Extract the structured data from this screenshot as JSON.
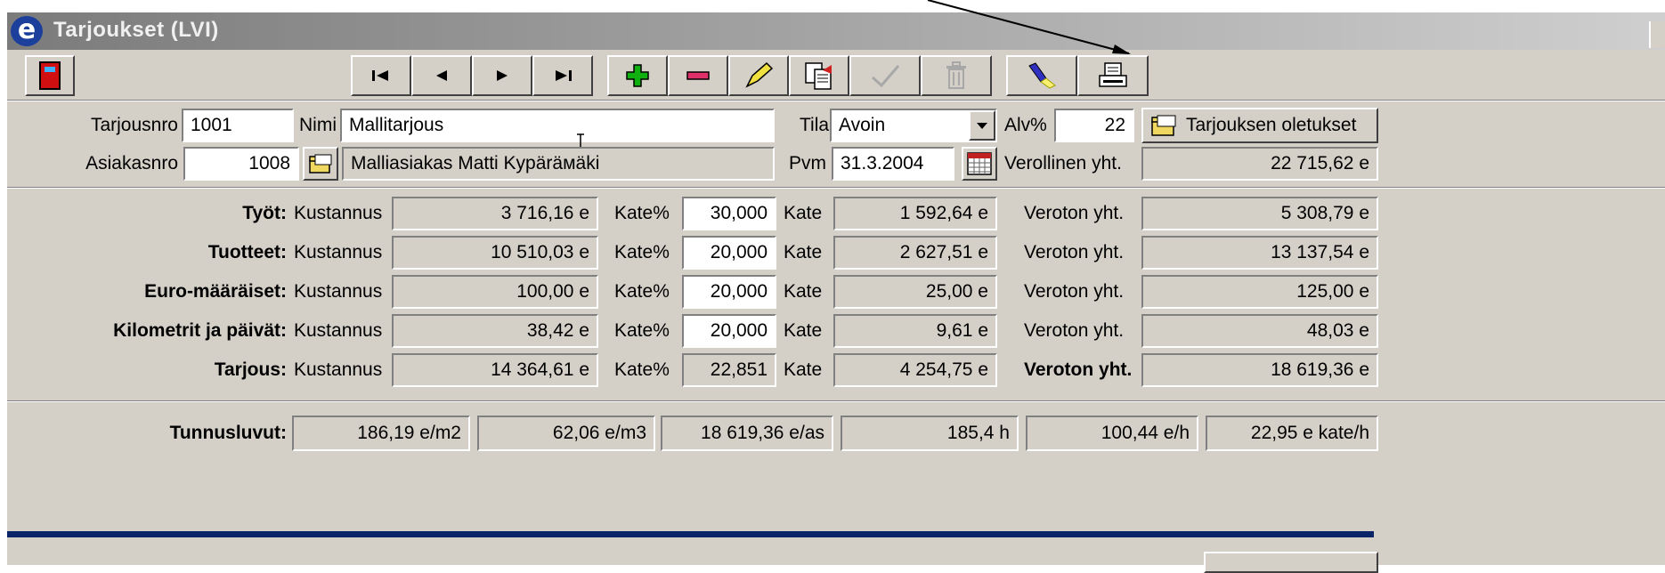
{
  "window": {
    "title": "Tarjoukset (LVI)",
    "logo_letter": "e"
  },
  "toolbar": {
    "exit_icon": "exit-door-icon",
    "nav": [
      {
        "name": "first-record-button",
        "icon": "first-icon"
      },
      {
        "name": "previous-record-button",
        "icon": "previous-icon"
      },
      {
        "name": "next-record-button",
        "icon": "next-icon"
      },
      {
        "name": "last-record-button",
        "icon": "last-icon"
      }
    ],
    "actions": [
      {
        "name": "add-record-button",
        "icon": "plus-icon"
      },
      {
        "name": "delete-record-button",
        "icon": "minus-icon"
      },
      {
        "name": "edit-record-button",
        "icon": "pencil-icon"
      },
      {
        "name": "copy-record-button",
        "icon": "copy-document-icon"
      },
      {
        "name": "confirm-button",
        "icon": "checkmark-icon"
      },
      {
        "name": "trash-button",
        "icon": "trash-icon"
      },
      {
        "name": "search-button",
        "icon": "flashlight-icon"
      },
      {
        "name": "print-button",
        "icon": "printer-icon"
      }
    ]
  },
  "header": {
    "tarjousnro_label": "Tarjousnro",
    "tarjousnro_value": "1001",
    "nimi_label": "Nimi",
    "nimi_value": "Mallitarjous",
    "tila_label": "Tila",
    "tila_value": "Avoin",
    "alv_label": "Alv%",
    "alv_value": "22",
    "defaults_button": "Tarjouksen oletukset",
    "asiakasnro_label": "Asiakasnro",
    "asiakasnro_value": "1008",
    "customer_name": "Malliasiakas Matti Kypäräмäki",
    "pvm_label": "Pvm",
    "pvm_value": "31.3.2004",
    "verollinen_label": "Verollinen yht.",
    "verollinen_value": "22 715,62 e"
  },
  "rows": [
    {
      "label": "Työt:",
      "kustannus_label": "Kustannus",
      "kustannus": "3 716,16 e",
      "kate_pct_label": "Kate%",
      "kate_pct": "30,000",
      "kate_label": "Kate",
      "kate": "1 592,64 e",
      "total_label": "Veroton yht.",
      "total": "5 308,79 e"
    },
    {
      "label": "Tuotteet:",
      "kustannus_label": "Kustannus",
      "kustannus": "10 510,03 e",
      "kate_pct_label": "Kate%",
      "kate_pct": "20,000",
      "kate_label": "Kate",
      "kate": "2 627,51 e",
      "total_label": "Veroton yht.",
      "total": "13 137,54 e"
    },
    {
      "label": "Euro-määräiset:",
      "kustannus_label": "Kustannus",
      "kustannus": "100,00 e",
      "kate_pct_label": "Kate%",
      "kate_pct": "20,000",
      "kate_label": "Kate",
      "kate": "25,00 e",
      "total_label": "Veroton yht.",
      "total": "125,00 e"
    },
    {
      "label": "Kilometrit ja päivät:",
      "kustannus_label": "Kustannus",
      "kustannus": "38,42 e",
      "kate_pct_label": "Kate%",
      "kate_pct": "20,000",
      "kate_label": "Kate",
      "kate": "9,61 e",
      "total_label": "Veroton yht.",
      "total": "48,03 e"
    },
    {
      "label": "Tarjous:",
      "kustannus_label": "Kustannus",
      "kustannus": "14 364,61 e",
      "kate_pct_label": "Kate%",
      "kate_pct": "22,851",
      "kate_label": "Kate",
      "kate": "4 254,75 e",
      "total_label": "Veroton yht.",
      "total": "18 619,36 e"
    }
  ],
  "metrics": {
    "label": "Tunnusluvut:",
    "values": [
      "186,19 e/m2",
      "62,06 e/m3",
      "18 619,36 e/as",
      "185,4 h",
      "100,44 e/h",
      "22,95 e kate/h"
    ]
  }
}
